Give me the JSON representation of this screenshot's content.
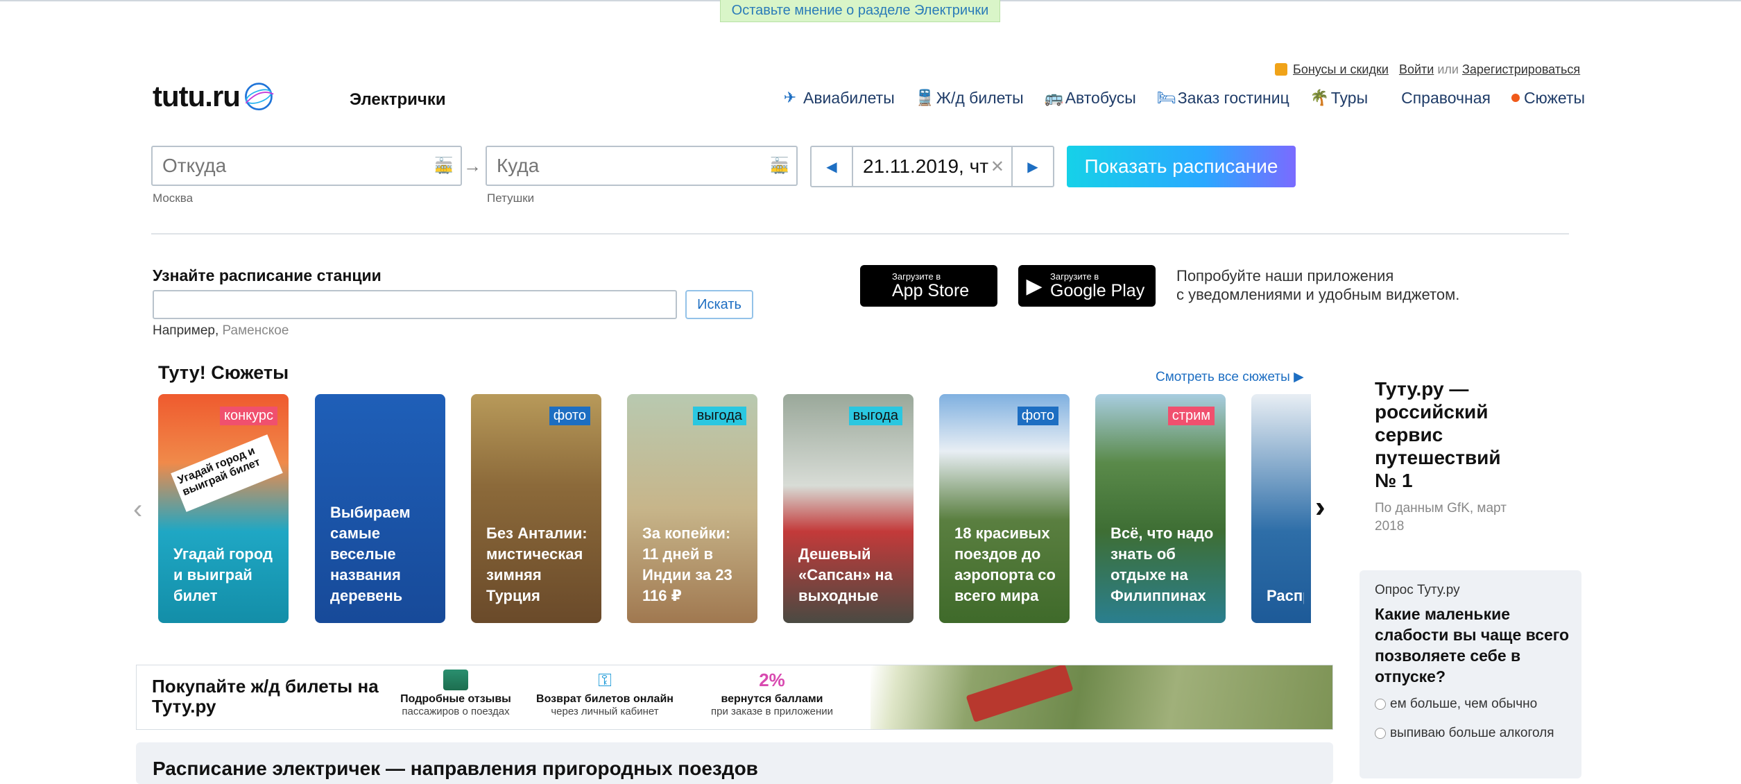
{
  "feedback": "Оставьте мнение о разделе Электрички",
  "header": {
    "logo_text": "tutu.ru",
    "section": "Электрички",
    "bonus": "Бонусы и скидки",
    "login": "Войти",
    "or": "или",
    "register": "Зарегистрироваться"
  },
  "nav": {
    "avia": "Авиабилеты",
    "rail": "Ж/д билеты",
    "bus": "Автобусы",
    "hotel": "Заказ гостиниц",
    "tours": "Туры",
    "reference": "Справочная",
    "stories": "Сюжеты"
  },
  "search": {
    "from_placeholder": "Откуда",
    "from_hint": "Москва",
    "to_placeholder": "Куда",
    "to_hint": "Петушки",
    "date": "21.11.2019, чт",
    "show_button": "Показать расписание"
  },
  "station": {
    "title": "Узнайте расписание станции",
    "search_button": "Искать",
    "example_prefix": "Например,",
    "example_link": "Раменское"
  },
  "apps": {
    "appstore_small": "Загрузите в",
    "appstore_big": "App Store",
    "gplay_small": "Загрузите в",
    "gplay_big": "Google Play",
    "text_line1": "Попробуйте наши приложения",
    "text_line2": "с уведомлениями и удобным виджетом."
  },
  "stories": {
    "title": "Туту! Сюжеты",
    "all": "Смотреть все сюжеты",
    "items": [
      {
        "tag": "конкурс",
        "text": "Угадай город и выиграй билет",
        "ticket": "Угадай город и выиграй билет"
      },
      {
        "tag": "",
        "text": "Выбираем самые веселые названия деревень"
      },
      {
        "tag": "фото",
        "text": "Без Анталии: мистическая зимняя Турция"
      },
      {
        "tag": "выгода",
        "text": "За копейки: 11 дней в Индии за 23 116 ₽"
      },
      {
        "tag": "выгода",
        "text": "Дешевый «Сапсан» на выходные"
      },
      {
        "tag": "фото",
        "text": "18 красивых поездов до аэропорта со всего мира"
      },
      {
        "tag": "стрим",
        "text": "Всё, что надо знать об отдыхе на Филиппинах"
      },
      {
        "tag": "",
        "text": "Распр билет Росси ближ заруб"
      }
    ]
  },
  "claim": {
    "title": "Туту.ру — российский сервис путешествий № 1",
    "source": "По данным GfK, март 2018"
  },
  "poll": {
    "label": "Опрос Туту.ру",
    "question": "Какие маленькие слабости вы чаще всего позволяете себе в отпуске?",
    "options": [
      "ем больше, чем обычно",
      "выпиваю больше алкоголя"
    ]
  },
  "banner": {
    "title": "Покупайте ж/д билеты на Туту.ру",
    "features": [
      {
        "title": "Подробные отзывы",
        "sub": "пассажиров о поездах"
      },
      {
        "title": "Возврат билетов онлайн",
        "sub": "через личный кабинет"
      },
      {
        "title": "вернутся баллами",
        "sub": "при заказе в приложении",
        "badge": "2%"
      }
    ]
  },
  "bottom": {
    "title": "Расписание электричек — направления пригородных поездов"
  }
}
